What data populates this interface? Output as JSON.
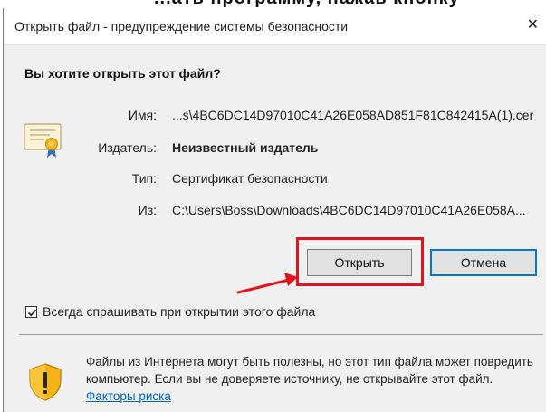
{
  "top_strip_text": "...ать программу, нажав кнопку «Открыть» (",
  "dialog": {
    "title": "Открыть файл - предупреждение системы безопасности",
    "close_symbol": "✕",
    "question": "Вы хотите открыть этот файл?"
  },
  "details": {
    "name_label": "Имя:",
    "name_value": "...s\\4BC6DC14D97010C41A26E058AD851F81C842415A(1).cer",
    "publisher_label": "Издатель:",
    "publisher_value": "Неизвестный издатель",
    "type_label": "Тип:",
    "type_value": "Сертификат безопасности",
    "from_label": "Из:",
    "from_value": "C:\\Users\\Boss\\Downloads\\4BC6DC14D97010C41A26E058A..."
  },
  "buttons": {
    "open_label": "Открыть",
    "cancel_label": "Отмена"
  },
  "checkbox": {
    "label": "Всегда спрашивать при открытии этого файла",
    "checked": true
  },
  "warning": {
    "text": "Файлы из Интернета могут быть полезны, но этот тип файла может повредить компьютер. Если вы не доверяете источнику, не открывайте этот файл. ",
    "link_text": "Факторы риска"
  },
  "colors": {
    "highlight_red": "#e3141b",
    "cancel_focus_blue": "#0078d7",
    "link_blue": "#0066cc"
  }
}
